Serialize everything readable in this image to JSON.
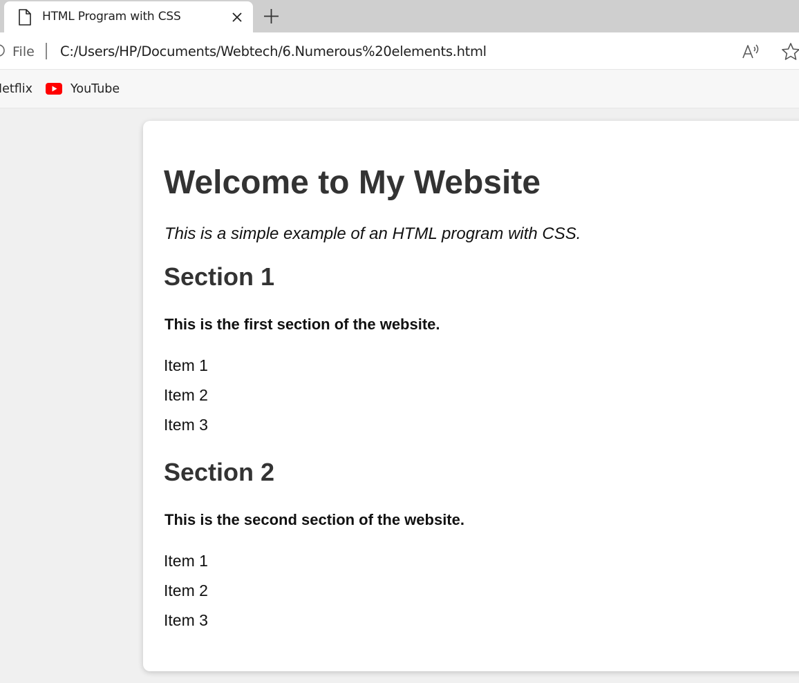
{
  "browser": {
    "tab": {
      "title": "HTML Program with CSS"
    },
    "address": {
      "scheme_label": "File",
      "url": "C:/Users/HP/Documents/Webtech/6.Numerous%20elements.html"
    },
    "bookmarks": [
      {
        "label": "Netflix"
      },
      {
        "label": "YouTube"
      }
    ],
    "colors": {
      "youtube_red": "#ff0000"
    }
  },
  "page": {
    "title": "Welcome to My Website",
    "intro": "This is a simple example of an HTML program with CSS.",
    "sections": [
      {
        "heading": "Section 1",
        "description": "This is the first section of the website.",
        "items": [
          "Item 1",
          "Item 2",
          "Item 3"
        ]
      },
      {
        "heading": "Section 2",
        "description": "This is the second section of the website.",
        "items": [
          "Item 1",
          "Item 2",
          "Item 3"
        ]
      }
    ]
  }
}
